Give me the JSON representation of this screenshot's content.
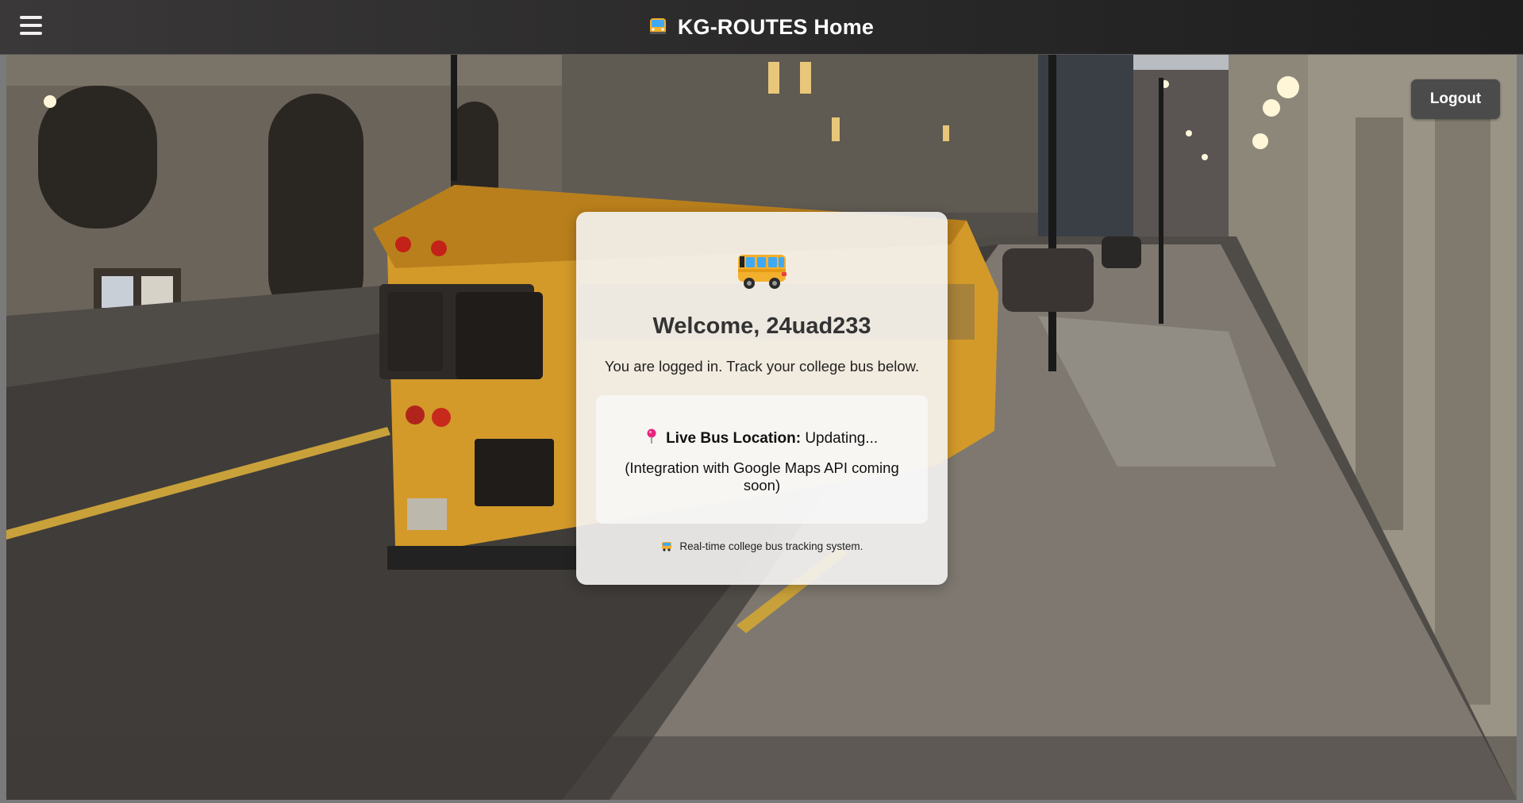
{
  "header": {
    "title": "KG-ROUTES Home",
    "menu_icon": "hamburger-menu-icon",
    "title_icon": "bus-front-icon"
  },
  "actions": {
    "logout_label": "Logout"
  },
  "card": {
    "icon": "bus-icon",
    "welcome": "Welcome, 24uad233",
    "subtitle": "You are logged in. Track your college bus below.",
    "location": {
      "icon": "map-pin-icon",
      "label": "Live Bus Location:",
      "status": "Updating..."
    },
    "integration_note": "(Integration with Google Maps API coming soon)",
    "footer": {
      "icon": "bus-icon",
      "text": "Real-time college bus tracking system."
    }
  },
  "colors": {
    "header_bg": "#2b2a2a",
    "button_bg": "#4b4b4b",
    "card_bg": "#f5f4f3",
    "bus_yellow": "#f3b02e",
    "bus_blue": "#3fa9f5"
  }
}
